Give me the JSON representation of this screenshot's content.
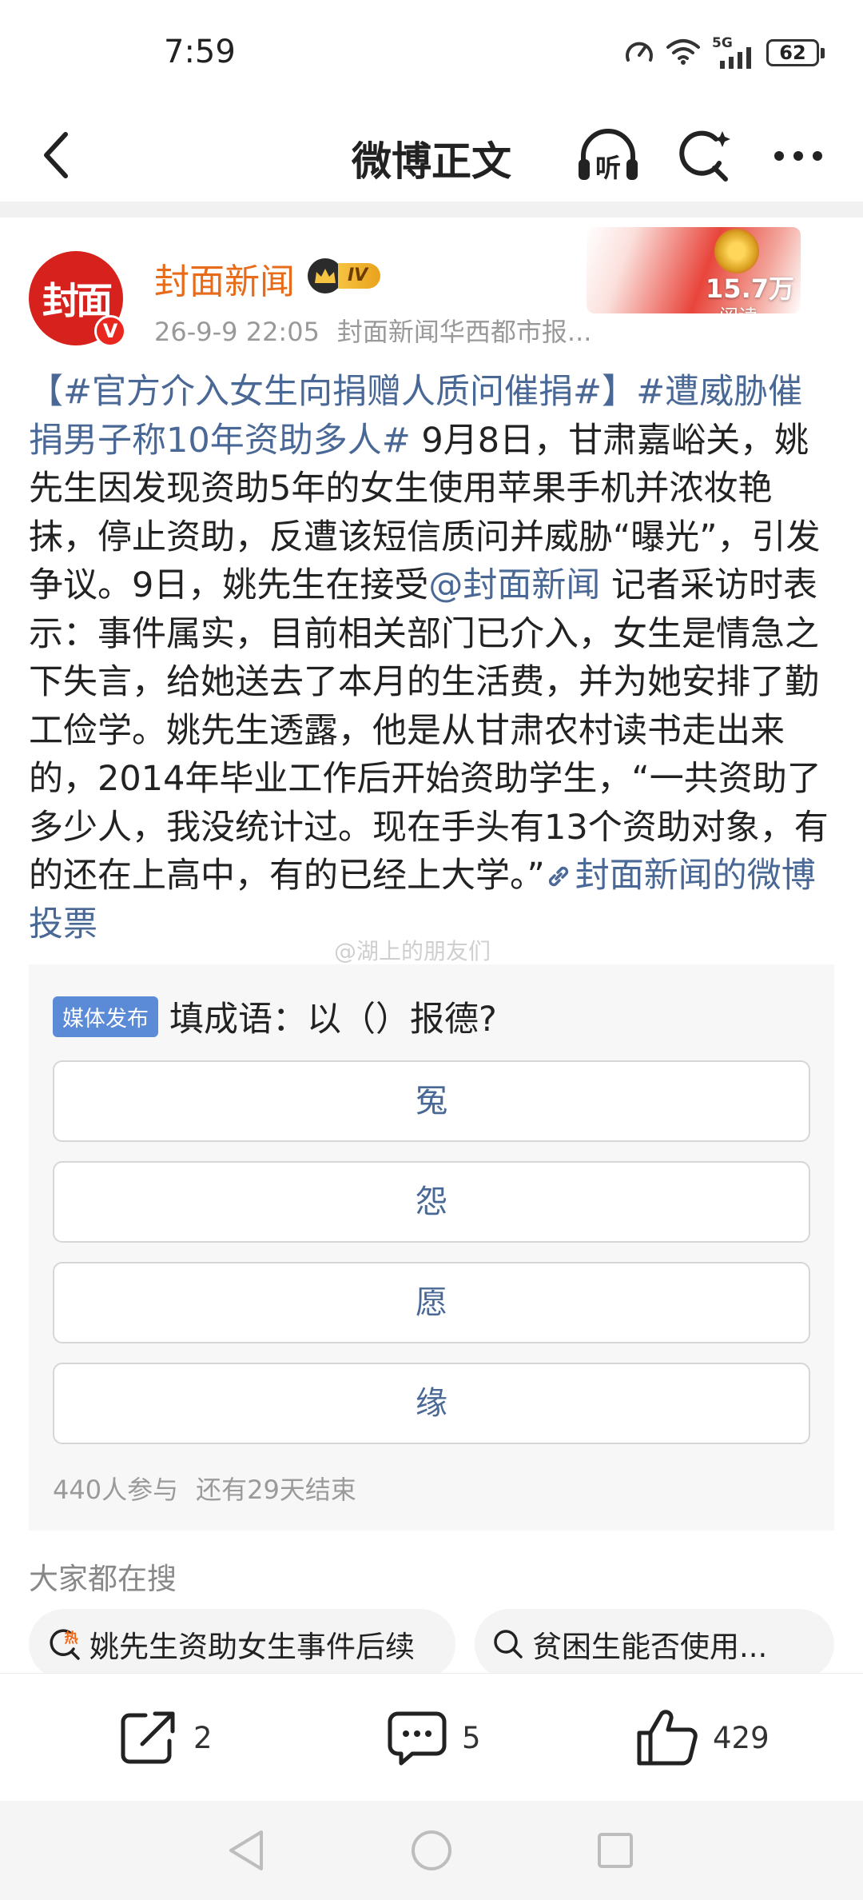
{
  "status_bar": {
    "time": "7:59",
    "network": "5G",
    "battery": "62"
  },
  "header": {
    "title": "微博正文",
    "listen_label": "听"
  },
  "author": {
    "avatar_text": "封面",
    "verified_mark": "V",
    "name": "封面新闻",
    "vip_level": "IV",
    "timestamp": "26-9-9 22:05",
    "source": "封面新闻华西都市报...",
    "read_count": "15.7万",
    "read_label": "阅读"
  },
  "post": {
    "tag1": "【#官方介入女生向捐赠人质问催捐#】",
    "tag2": "#遭威胁催捐男子称10年资助多人#",
    "text1": " 9月8日，甘肃嘉峪关，姚先生因发现资助5年的女生使用苹果手机并浓妆艳抹，停止资助，反遭该短信质问并威胁“曝光”，引发争议。9日，姚先生在接受",
    "mention": "@封面新闻",
    "text2": " 记者采访时表示：事件属实，目前相关部门已介入，女生是情急之下失言，给她送去了本月的生活费，并为她安排了勤工俭学。姚先生透露，他是从甘肃农村读书走出来的，2014年毕业工作后开始资助学生，“一共资助了多少人，我没统计过。现在手头有13个资助对象，有的还在上高中，有的已经上大学。”",
    "poll_link": "封面新闻的微博投票",
    "watermark": "@湖上的朋友们"
  },
  "poll": {
    "badge": "媒体发布",
    "question": "填成语：以（）报德?",
    "options": [
      "冤",
      "怨",
      "愿",
      "缘"
    ],
    "participants": "440人参与",
    "remaining": "还有29天结束"
  },
  "trending": {
    "title": "大家都在搜",
    "items": [
      {
        "label": "姚先生资助女生事件后续",
        "icon": "hot-search-icon",
        "badge": "热"
      },
      {
        "label": "贫困生能否使用...",
        "icon": "search-icon"
      }
    ]
  },
  "actions": {
    "share_count": "2",
    "comment_count": "5",
    "like_count": "429"
  },
  "colors": {
    "link": "#4a6896",
    "author_name": "#e86b1a",
    "poll_badge": "#5b8bd6",
    "avatar": "#d6211c"
  }
}
